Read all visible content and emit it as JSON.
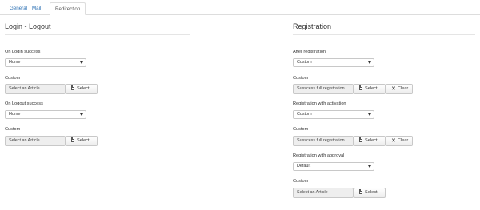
{
  "tabs": [
    {
      "label": "General"
    },
    {
      "label": "Mail"
    },
    {
      "label": "Redirection"
    }
  ],
  "left": {
    "title": "Login - Logout",
    "login_success_label": "On Login success",
    "login_success_value": "Home",
    "custom1_label": "Custom",
    "custom1_value": "Select an Article",
    "custom1_select": "Select",
    "logout_success_label": "On Logout success",
    "logout_success_value": "Home",
    "custom2_label": "Custom",
    "custom2_value": "Select an Article",
    "custom2_select": "Select"
  },
  "right": {
    "title": "Registration",
    "after_reg_label": "After registration",
    "after_reg_value": "Custom",
    "custom1_label": "Custom",
    "custom1_value": "Susscess full registration",
    "custom1_select": "Select",
    "custom1_clear": "Clear",
    "reg_activation_label": "Registration with activation",
    "reg_activation_value": "Custom",
    "custom2_label": "Custom",
    "custom2_value": "Susscess full registration",
    "custom2_select": "Select",
    "custom2_clear": "Clear",
    "reg_approval_label": "Registration with approval",
    "reg_approval_value": "Default",
    "custom3_label": "Custom",
    "custom3_value": "Select an Article",
    "custom3_select": "Select"
  },
  "icons": {
    "select": "document-icon",
    "clear": "close-icon",
    "dropdown": "chevron-down-icon"
  }
}
